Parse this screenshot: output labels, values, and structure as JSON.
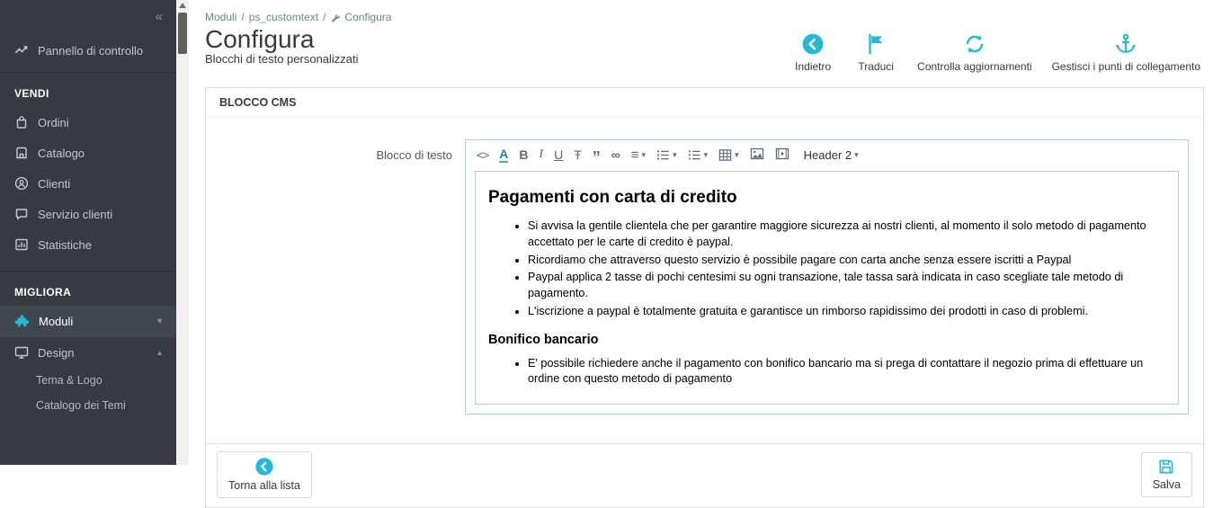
{
  "colors": {
    "accent": "#25b9d7",
    "sidebar_bg": "#363a41"
  },
  "icons": {
    "collapse": "«",
    "chevron_down": "▾",
    "chevron_up": "▴",
    "caret": "▾",
    "separator": "/"
  },
  "sidebar": {
    "dashboard": "Pannello di controllo",
    "section_sell": "VENDI",
    "sell_items": [
      "Ordini",
      "Catalogo",
      "Clienti",
      "Servizio clienti",
      "Statistiche"
    ],
    "section_improve": "MIGLIORA",
    "modules": "Moduli",
    "design": "Design",
    "design_subitems": [
      "Tema & Logo",
      "Catalogo dei Temi"
    ]
  },
  "breadcrumb": {
    "items": [
      "Moduli",
      "ps_customtext",
      "Configura"
    ]
  },
  "header": {
    "title": "Configura",
    "subtitle": "Blocchi di testo personalizzati",
    "actions": [
      "Indietro",
      "Traduci",
      "Controlla aggiornamenti",
      "Gestisci i punti di collegamento"
    ]
  },
  "panel": {
    "title": "BLOCCO CMS",
    "field_label": "Blocco di testo"
  },
  "editor": {
    "toolbar": {
      "code": "<>",
      "fontcolor": "A",
      "bold": "B",
      "italic": "I",
      "underline": "U",
      "strike": "Ŧ",
      "quote": "”",
      "link": "∞",
      "align": "≡",
      "header_select": "Header 2"
    },
    "heading1": "Pagamenti con carta di credito",
    "list1": [
      "Si avvisa la gentile clientela che per garantire maggiore sicurezza ai nostri clienti, al momento il solo metodo di pagamento accettato per le carte di credito è paypal.",
      "Ricordiamo che attraverso questo servizio è possibile pagare con carta anche senza essere iscritti a Paypal",
      "Paypal applica 2 tasse di pochi centesimi su ogni transazione, tale tassa sarà indicata in caso scegliate tale metodo di pagamento.",
      "L'iscrizione a paypal è totalmente gratuita e garantisce un rimborso rapidissimo dei prodotti in caso di problemi."
    ],
    "heading2": "Bonifico bancario",
    "list2": [
      "E' possibile richiedere anche il pagamento con bonifico bancario ma si prega di contattare il negozio prima di effettuare un ordine con questo metodo di pagamento"
    ]
  },
  "footer": {
    "back": "Torna alla lista",
    "save": "Salva"
  }
}
